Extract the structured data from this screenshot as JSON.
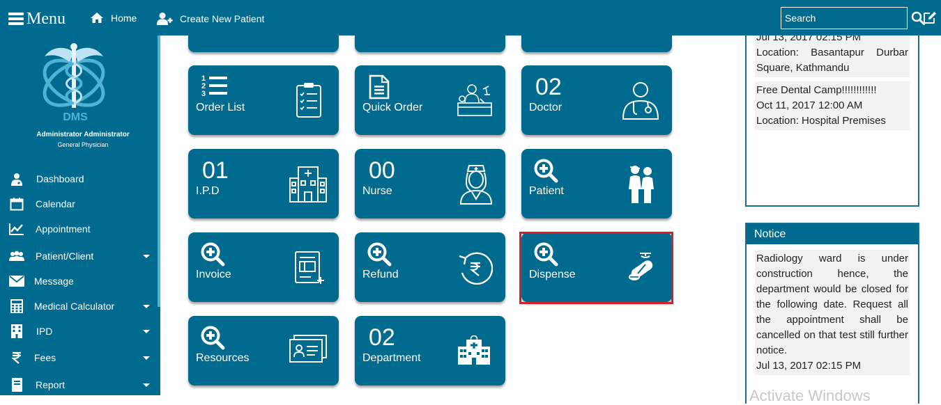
{
  "header": {
    "menu_label": "Menu",
    "home_label": "Home",
    "create_patient_label": "Create New Patient",
    "search_placeholder": "Search"
  },
  "sidebar": {
    "logo_text": "DMS",
    "user_name": "Administrator Administrator",
    "user_role": "General Physician",
    "items": [
      {
        "label": "Dashboard",
        "icon": "doctor-icon",
        "has_caret": false
      },
      {
        "label": "Calendar",
        "icon": "calendar-icon",
        "has_caret": false
      },
      {
        "label": "Appointment",
        "icon": "line-chart-icon",
        "has_caret": false
      },
      {
        "label": "Patient/Client",
        "icon": "users-icon",
        "has_caret": true
      },
      {
        "label": "Message",
        "icon": "envelope-icon",
        "has_caret": false
      },
      {
        "label": "Medical Calculator",
        "icon": "calculator-icon",
        "has_caret": true
      },
      {
        "label": "IPD",
        "icon": "building-icon",
        "has_caret": true
      },
      {
        "label": "Fees",
        "icon": "rupee-icon",
        "has_caret": true
      },
      {
        "label": "Report",
        "icon": "book-icon",
        "has_caret": true
      }
    ]
  },
  "tiles": {
    "order_list": {
      "label": "Order List",
      "icon": "clipboard-checklist-icon"
    },
    "quick_order": {
      "label": "Quick Order",
      "icon": "lab-worker-icon"
    },
    "doctor": {
      "count": "02",
      "label": "Doctor",
      "icon": "doctor-stethoscope-icon"
    },
    "ipd": {
      "count": "01",
      "label": "I.P.D",
      "icon": "hospital-building-icon"
    },
    "nurse": {
      "count": "00",
      "label": "Nurse",
      "icon": "nurse-icon"
    },
    "patient": {
      "label": "Patient",
      "icon": "patient-couple-icon"
    },
    "invoice": {
      "label": "Invoice",
      "icon": "invoice-document-icon"
    },
    "refund": {
      "label": "Refund",
      "icon": "rupee-refund-icon"
    },
    "dispense": {
      "label": "Dispense",
      "icon": "pills-icon"
    },
    "resources": {
      "label": "Resources",
      "icon": "id-cards-icon"
    },
    "department": {
      "count": "02",
      "label": "Department",
      "icon": "hospital-icon"
    }
  },
  "events": {
    "items": [
      {
        "title": "Jul 13, 2017 02:15 PM",
        "location": "Location: Basantapur Durbar Square, Kathmandu"
      },
      {
        "title": "Free Dental Camp!!!!!!!!!!!!",
        "date": "Oct 11, 2017 12:00 AM",
        "location": "Location: Hospital Premises"
      }
    ]
  },
  "notice": {
    "title": "Notice",
    "text": "Radiology ward is under construction hence, the department would be closed for the following date. Request all the appointment shall be cancelled on that test still further notice.",
    "date": "Jul 13, 2017 02:15 PM"
  },
  "watermark": "Activate Windows",
  "colors": {
    "primary": "#006b8f",
    "highlight": "#d31f25",
    "panel_bg": "#f2f2f2"
  }
}
